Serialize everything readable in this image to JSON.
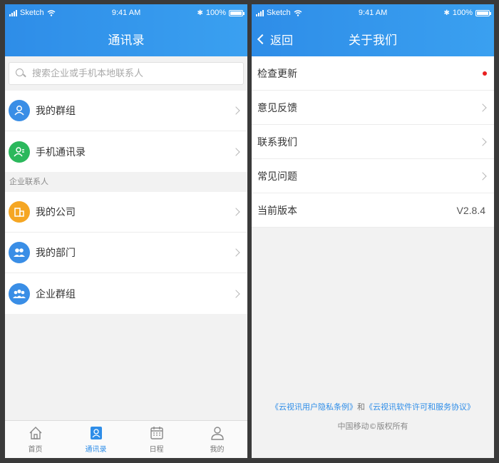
{
  "status_bar": {
    "carrier": "Sketch",
    "time": "9:41 AM",
    "battery": "100%"
  },
  "contacts_screen": {
    "title": "通讯录",
    "search_placeholder": "搜索企业或手机本地联系人",
    "top_items": [
      {
        "label": "我的群组",
        "color": "#3a8ee6"
      },
      {
        "label": "手机通讯录",
        "color": "#2bb85c"
      }
    ],
    "section_title": "企业联系人",
    "enterprise_items": [
      {
        "label": "我的公司",
        "color": "#f5a623"
      },
      {
        "label": "我的部门",
        "color": "#3a8ee6"
      },
      {
        "label": "企业群组",
        "color": "#3a8ee6"
      }
    ],
    "tabs": [
      {
        "label": "首页",
        "icon": "home-icon"
      },
      {
        "label": "通讯录",
        "icon": "contacts-icon",
        "active": true
      },
      {
        "label": "日程",
        "icon": "calendar-icon"
      },
      {
        "label": "我的",
        "icon": "profile-icon"
      }
    ]
  },
  "about_screen": {
    "back_label": "返回",
    "title": "关于我们",
    "items": [
      {
        "label": "检查更新"
      },
      {
        "label": "意见反馈"
      },
      {
        "label": "联系我们"
      },
      {
        "label": "常见问题"
      }
    ],
    "version_label": "当前版本",
    "version_value": "V2.8.4",
    "privacy_link": "《云视讯用户隐私条例》",
    "link_joiner": "和",
    "license_link": "《云视讯软件许可和服务协议》",
    "copyright": "中国移动©版权所有"
  },
  "colors": {
    "accent": "#2e8de8",
    "badge_red": "#e82020"
  }
}
